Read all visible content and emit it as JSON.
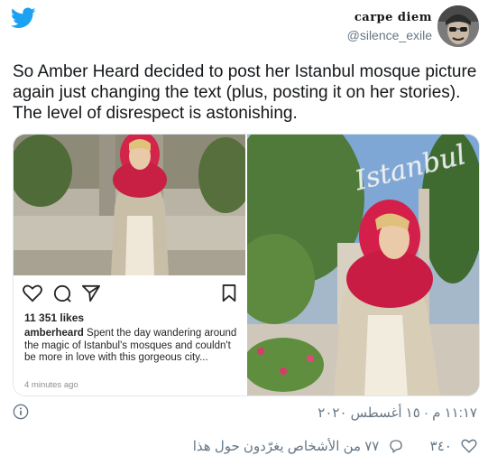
{
  "author": {
    "name": "carpe diem",
    "handle": "@silence_exile"
  },
  "tweet": {
    "text": "So Amber Heard decided to post her Istanbul mosque picture again just changing the text (plus, posting it on her stories). The level of disrespect is astonishing."
  },
  "media": {
    "instagram": {
      "likes": "11 351 likes",
      "username": "amberheard",
      "caption": " Spent the day wandering around the magic of Istanbul's mosques and couldn't be more in love with this gorgeous city...",
      "time": "4 minutes ago"
    },
    "story": {
      "overlay_text": "Istanbul"
    }
  },
  "footer": {
    "timestamp": "١١:١٧ م · ١٥ أغسطس ٢٠٢٠",
    "likes_count": "٣٤٠",
    "replies_text": "٧٧ من الأشخاص يغرّدون حول هذا"
  },
  "icons": {
    "twitter": "twitter-bird-icon",
    "info": "info-icon",
    "heart": "heart-icon",
    "reply": "reply-icon"
  },
  "colors": {
    "twitter_blue": "#1da1f2",
    "muted": "#657786",
    "scarf": "#d21f45"
  }
}
